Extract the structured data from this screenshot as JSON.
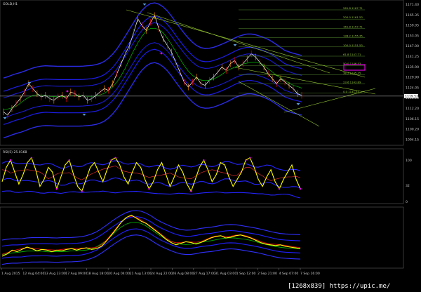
{
  "window": {
    "symbol_label": "GOLD,H1"
  },
  "rsi_label": "RSI(5) 25.0168",
  "watermark": "[1268x839] https://upic.me/",
  "colors": {
    "background": "#000000",
    "price": "#ffffff",
    "ma_fast": "#ffff00",
    "ma_mid": "#ff0000",
    "ma_slow": "#00c000",
    "envelope": "#2020ff",
    "outer_envelope": "#3030ff",
    "trend_line": "#9acd32",
    "fib": "#558b2f",
    "rsi": "#ffff00",
    "rsi_dots": "#ff00ff",
    "rsi_band": "#2424ff",
    "arrow": "#5b9bd5",
    "marker": "#ff00ff",
    "current_price_line": "#c0c0c0"
  },
  "chart_data": [
    {
      "type": "line",
      "title": "GOLD,H1",
      "x_tick_labels": [
        "1 Aug 2015",
        "12 Aug 04:00",
        "13 Aug 23:00",
        "17 Aug 09:00",
        "18 Aug 18:00",
        "20 Aug 04:00",
        "21 Aug 13:00",
        "24 Aug 22:00",
        "26 Aug 08:00",
        "27 Aug 17:00",
        "31 Aug 03:00",
        "1 Sep 12:00",
        "2 Sep 21:00",
        "4 Sep 07:00",
        "7 Sep 16:00"
      ],
      "y_tick_labels": [
        "1171.40",
        "1165.35",
        "1159.05",
        "1153.05",
        "1147.00",
        "1141.25",
        "1135.90",
        "1129.90",
        "1124.05",
        "1118.10",
        "1112.20",
        "1106.15",
        "1100.20",
        "1094.15"
      ],
      "ylim": [
        1092,
        1174
      ],
      "current_price": "1119.52",
      "fib_levels": [
        {
          "label": "261.8 1167.71",
          "value": 1167.71
        },
        {
          "label": "200.0 1161.53",
          "value": 1161.53
        },
        {
          "label": "161.8 1157.71",
          "value": 1157.71
        },
        {
          "label": "138.2 1155.35",
          "value": 1155.35
        },
        {
          "label": "100.0 1151.53",
          "value": 1151.53
        },
        {
          "label": "61.8 1147.71",
          "value": 1147.71
        },
        {
          "label": "50.0 1146.53",
          "value": 1146.53
        },
        {
          "label": "38.2 1145.35",
          "value": 1145.35
        },
        {
          "label": "23.6 1143.89",
          "value": 1143.89
        },
        {
          "label": "0.0 1141.53",
          "value": 1141.53
        }
      ],
      "series": [
        {
          "values": [
            1110,
            1108,
            1112,
            1115,
            1118,
            1122,
            1127,
            1124,
            1121,
            1119,
            1120,
            1118,
            1117,
            1119,
            1120,
            1118,
            1122,
            1121,
            1119,
            1120,
            1117,
            1118,
            1120,
            1122,
            1124,
            1123,
            1127,
            1133,
            1139,
            1145,
            1150,
            1158,
            1166,
            1162,
            1159,
            1164,
            1168,
            1160,
            1154,
            1150,
            1146,
            1140,
            1134,
            1128,
            1125,
            1128,
            1131,
            1127,
            1126,
            1129,
            1131,
            1134,
            1137,
            1135,
            1139,
            1141,
            1137,
            1139,
            1142,
            1145,
            1143,
            1140,
            1137,
            1133,
            1130,
            1127,
            1130,
            1128,
            1126,
            1124,
            1121,
            1120
          ]
        },
        {
          "values": [
            1112,
            1111,
            1111,
            1113,
            1115,
            1117,
            1120,
            1121,
            1121,
            1120,
            1120,
            1119,
            1119,
            1119,
            1119,
            1119,
            1120,
            1120,
            1120,
            1120,
            1119,
            1119,
            1119,
            1120,
            1121,
            1122,
            1124,
            1127,
            1131,
            1136,
            1141,
            1147,
            1154,
            1157,
            1159,
            1161,
            1163,
            1161,
            1158,
            1155,
            1151,
            1147,
            1142,
            1137,
            1133,
            1131,
            1130,
            1129,
            1128,
            1128,
            1129,
            1131,
            1133,
            1134,
            1136,
            1138,
            1138,
            1138,
            1139,
            1141,
            1141,
            1140,
            1139,
            1136,
            1134,
            1131,
            1130,
            1129,
            1128,
            1126,
            1124,
            1123
          ]
        }
      ]
    },
    {
      "type": "line",
      "title": "RSI(5) 25.0168",
      "y_tick_labels": [
        "100",
        "32",
        "0"
      ],
      "ylim": [
        0,
        100
      ],
      "series": [
        {
          "values": [
            40,
            70,
            85,
            60,
            35,
            55,
            80,
            90,
            65,
            30,
            45,
            70,
            60,
            25,
            50,
            75,
            85,
            55,
            30,
            20,
            45,
            70,
            80,
            60,
            40,
            65,
            85,
            90,
            75,
            50,
            35,
            60,
            80,
            70,
            45,
            25,
            40,
            65,
            80,
            55,
            30,
            50,
            75,
            60,
            35,
            20,
            45,
            70,
            85,
            65,
            40,
            55,
            80,
            75,
            50,
            30,
            45,
            60,
            85,
            90,
            70,
            45,
            30,
            50,
            65,
            40,
            25,
            45,
            60,
            75,
            45,
            25
          ]
        }
      ]
    },
    {
      "type": "line",
      "title": "",
      "series": [
        {
          "values": [
            1112,
            1115,
            1120,
            1118,
            1121,
            1124,
            1122,
            1119,
            1121,
            1120,
            1118,
            1120,
            1119,
            1121,
            1122,
            1120,
            1122,
            1123,
            1121,
            1122,
            1125,
            1132,
            1140,
            1148,
            1157,
            1163,
            1166,
            1162,
            1158,
            1155,
            1150,
            1145,
            1140,
            1134,
            1130,
            1127,
            1129,
            1131,
            1130,
            1128,
            1130,
            1133,
            1136,
            1138,
            1139,
            1136,
            1137,
            1139,
            1140,
            1138,
            1136,
            1133,
            1130,
            1128,
            1127,
            1126,
            1127,
            1125,
            1124,
            1123,
            1122
          ]
        }
      ]
    }
  ]
}
